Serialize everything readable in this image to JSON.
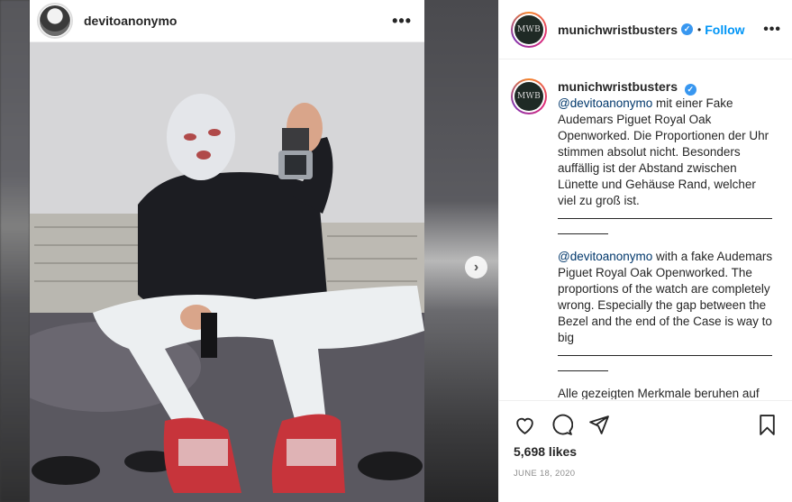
{
  "post": {
    "username": "devitoanonymo",
    "more": "•••"
  },
  "side": {
    "account": "munichwristbusters",
    "avatar_text": "MWB",
    "follow_sep": "•",
    "follow_label": "Follow",
    "more": "•••",
    "verified_glyph": "✓"
  },
  "caption": {
    "author": "munichwristbusters",
    "p1_mention": "@devitoanonymo",
    "p1_text": " mit einer Fake Audemars Piguet Royal Oak Openworked. Die Proportionen der Uhr stimmen absolut nicht. Besonders auffällig ist der Abstand zwischen Lünette und Gehäuse Rand, welcher viel zu groß ist.",
    "p2_mention": "@devitoanonymo",
    "p2_text": " with a fake Audemars Piguet Royal Oak Openworked. The proportions of the watch are completely wrong. Especially the gap between the Bezel and the end of the Case is way to big",
    "p3_text": "Alle gezeigten Merkmale beruhen auf mehrfacher Überprüfung. Bei"
  },
  "stats": {
    "likes": "5,698 likes",
    "date": "JUNE 18, 2020"
  },
  "colors": {
    "accent": "#0095f6",
    "verified": "#3897f0",
    "mention": "#00376b",
    "muted": "#8e8e8e"
  },
  "icons": [
    "heart-icon",
    "comment-icon",
    "share-icon",
    "bookmark-icon",
    "chevron-right-icon"
  ]
}
